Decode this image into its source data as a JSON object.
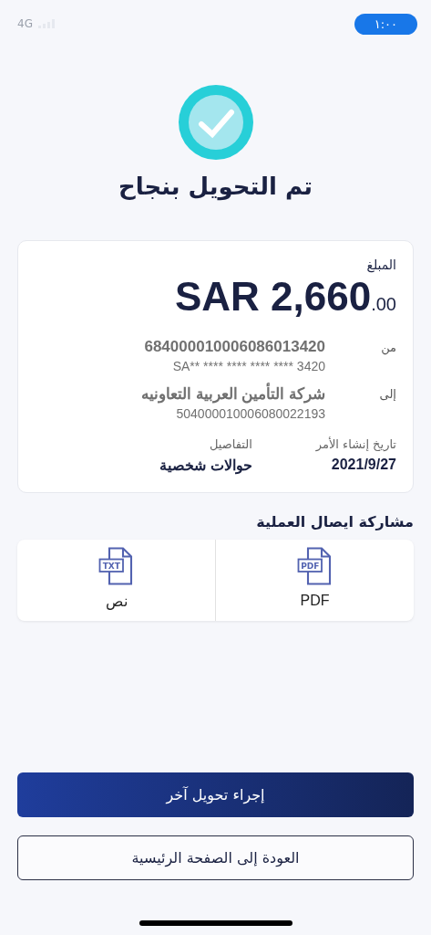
{
  "status_bar": {
    "network": "4G",
    "time": "١:٠٠"
  },
  "title": "تم التحويل بنجاح",
  "receipt": {
    "amount_label": "المبلغ",
    "amount_main": "SAR 2,660",
    "amount_decimals": ".00",
    "from": {
      "label": "من",
      "account": "684000010006086013420",
      "iban": "SA** **** **** **** **** 3420"
    },
    "to": {
      "label": "إلى",
      "name": "شركة التأمين العربية التعاونيه",
      "account": "504000010006080022193"
    },
    "details": [
      {
        "label": "تاريخ إنشاء الأمر",
        "value": "2021/9/27"
      },
      {
        "label": "التفاصيل",
        "value": "حوالات شخصية"
      }
    ]
  },
  "share": {
    "title": "مشاركة ايصال العملية",
    "options": [
      {
        "icon_text": "PDF",
        "label": "PDF"
      },
      {
        "icon_text": "TXT",
        "label": "نص"
      }
    ]
  },
  "buttons": [
    {
      "kind": "primary",
      "label": "إجراء تحويل آخر"
    },
    {
      "kind": "secondary",
      "label": "العودة إلى الصفحة الرئيسية"
    }
  ]
}
